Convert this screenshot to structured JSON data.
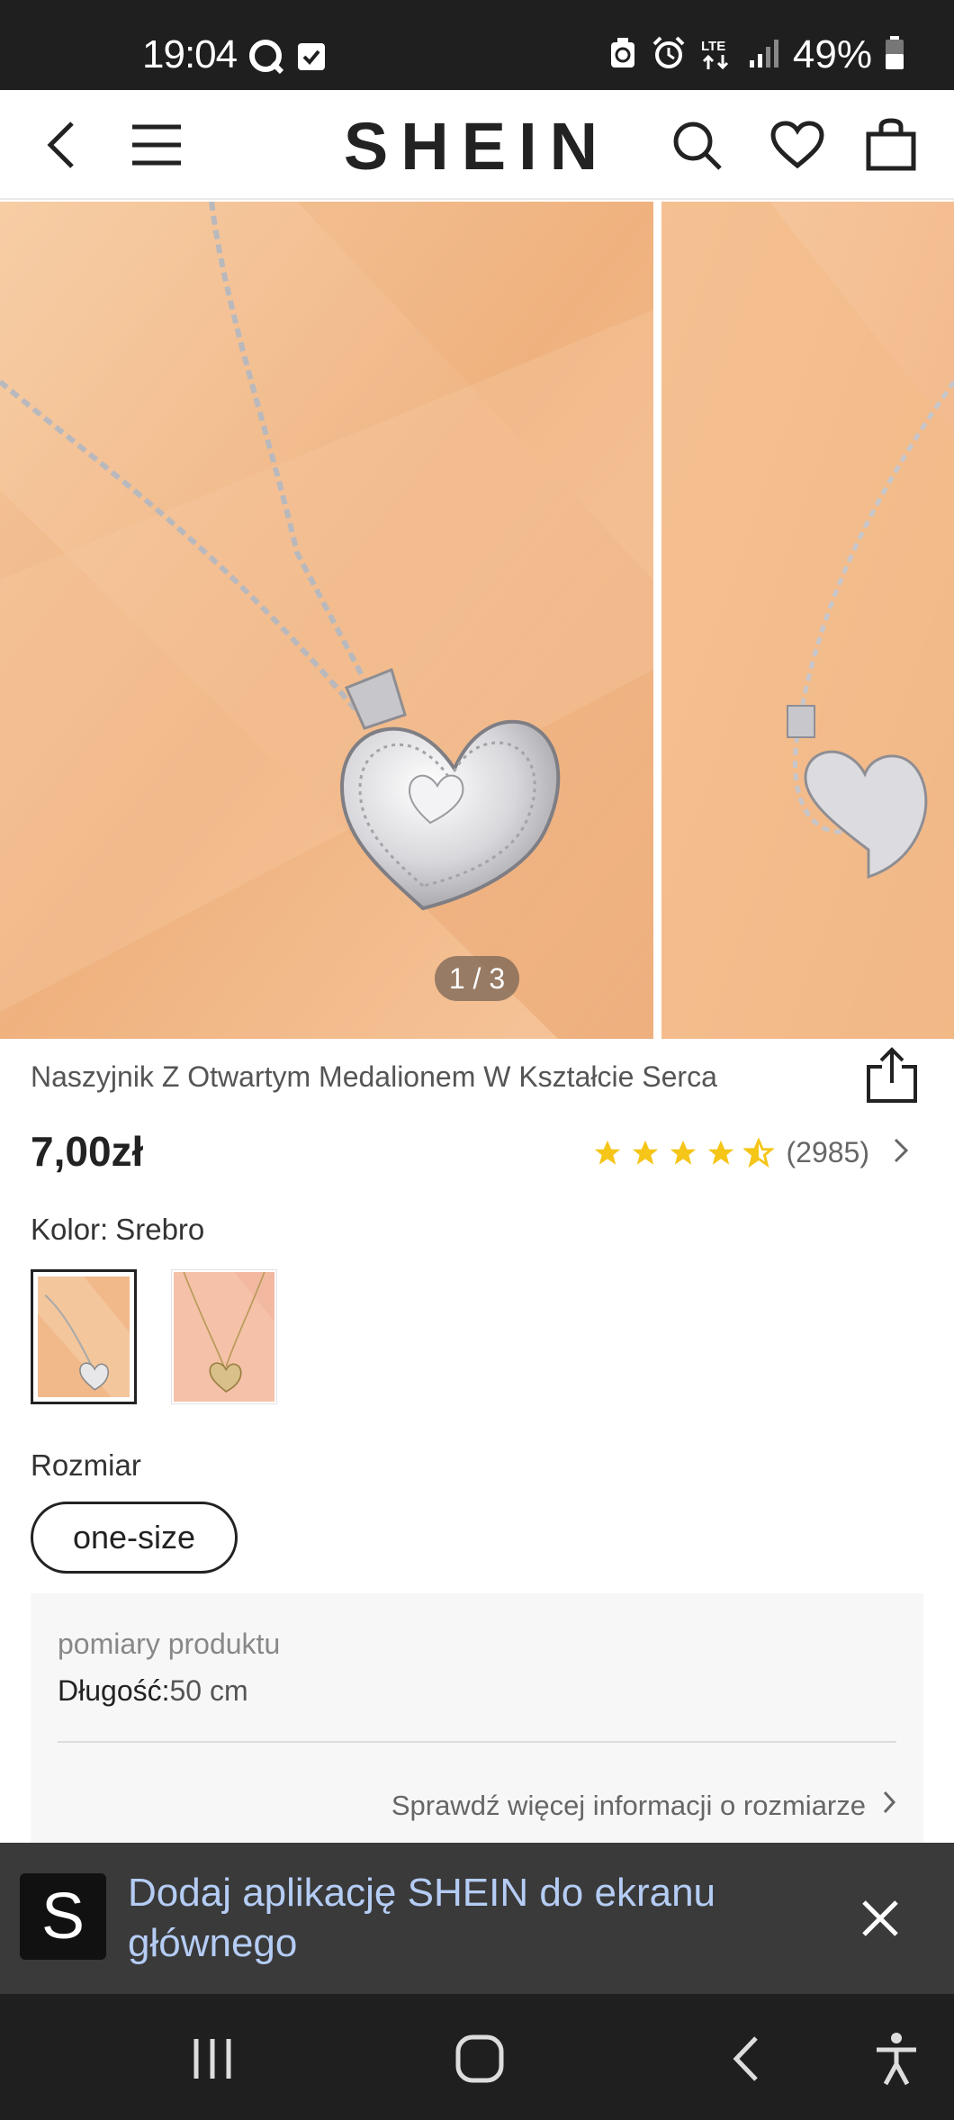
{
  "status_bar": {
    "time": "19:04",
    "battery": "49%",
    "network": "LTE"
  },
  "header": {
    "brand": "SHEIN",
    "icons": [
      "back-arrow-icon",
      "menu-icon",
      "search-icon",
      "heart-icon",
      "shopping-bag-icon"
    ]
  },
  "gallery": {
    "page_indicator": "1 / 3",
    "background_color": "#efb98a"
  },
  "product": {
    "title": "Naszyjnik Z Otwartym Medalionem W Kształcie Serca",
    "price": "7,00zł",
    "rating": 4.5,
    "review_count": "(2985)",
    "star_color": "#f5c518"
  },
  "color": {
    "label": "Kolor:",
    "value": "Srebro"
  },
  "size": {
    "label": "Rozmiar",
    "option": "one-size"
  },
  "measurements": {
    "title": "pomiary produktu",
    "length_label": "Długość:",
    "length_value": "50 cm",
    "more_link": "Sprawdź więcej informacji o rozmiarze"
  },
  "add_to_home": {
    "logo_letter": "S",
    "text": "Dodaj aplikację SHEIN do ekranu głównego",
    "text_color": "#b5cdf5"
  }
}
